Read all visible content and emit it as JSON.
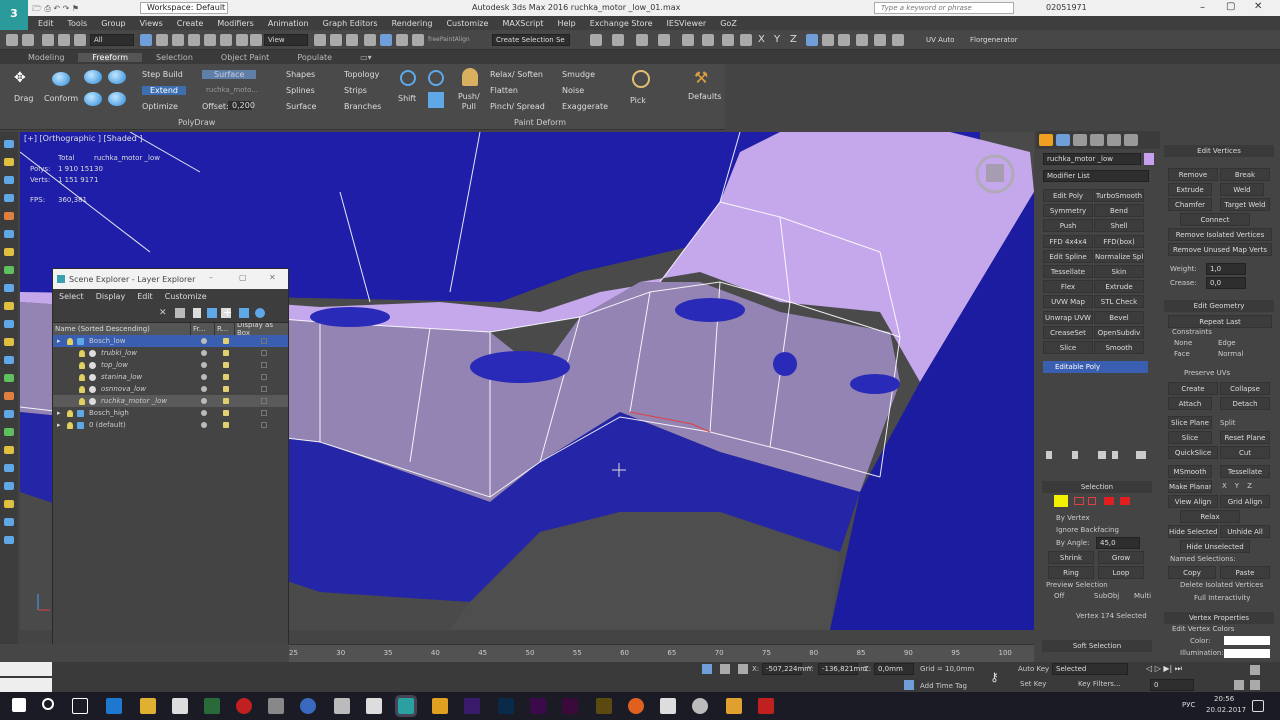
{
  "title_bar": {
    "workspace": "Workspace: Default",
    "title": "Autodesk 3ds Max 2016      ruchka_motor _low_01.max",
    "search_placeholder": "Type a keyword or phrase",
    "user": "02051971"
  },
  "menu": [
    "Edit",
    "Tools",
    "Group",
    "Views",
    "Create",
    "Modifiers",
    "Animation",
    "Graph Editors",
    "Rendering",
    "Customize",
    "MAXScript",
    "Help",
    "Exchange Store",
    "IESViewer",
    "GoZ"
  ],
  "toolbar": {
    "selection_filter": "All",
    "ref_coord": "View",
    "named_selection": "Create Selection Se",
    "plugin": "freePaintAlign",
    "axes": [
      "X",
      "Y",
      "Z"
    ],
    "uv_auto": "UV Auto",
    "florgenerator": "Florgenerator"
  },
  "ribbon_tabs": [
    "Modeling",
    "Freeform",
    "Selection",
    "Object Paint",
    "Populate"
  ],
  "ribbon_active": "Freeform",
  "ribbon": {
    "drag": "Drag",
    "conform": "Conform",
    "step_build": "Step Build",
    "extend": "Extend",
    "optimize": "Optimize",
    "surface_btn": "Surface",
    "surface_target": "ruchka_moto...",
    "offset_label": "Offset:",
    "offset_value": "0,200",
    "shapes": "Shapes",
    "splines": "Splines",
    "surface": "Surface",
    "topology": "Topology",
    "strips": "Strips",
    "branches": "Branches",
    "shift": "Shift",
    "push_pull": "Push/\nPull",
    "relax_soften": "Relax/ Soften",
    "flatten": "Flatten",
    "pinch_spread": "Pinch/ Spread",
    "smudge": "Smudge",
    "noise": "Noise",
    "exaggerate": "Exaggerate",
    "pick": "Pick",
    "defaults": "Defaults",
    "group_polydraw": "PolyDraw",
    "group_paint_deform": "Paint Deform"
  },
  "viewport": {
    "label": "[+] [Orthographic ] [Shaded ]",
    "stats_header_total": "Total",
    "stats_header_object": "ruchka_motor _low",
    "polys_label": "Polys:",
    "polys_total": "1 910 151",
    "polys_obj": "30",
    "verts_label": "Verts:",
    "verts_total": "1 151 917",
    "verts_obj": "1",
    "fps_label": "FPS:",
    "fps": "360,381"
  },
  "scene_explorer": {
    "title": "Scene Explorer - Layer Explorer",
    "menu": [
      "Select",
      "Display",
      "Edit",
      "Customize"
    ],
    "columns": [
      "Name (Sorted Descending)",
      "Fr...",
      "R...",
      "Display as Box"
    ],
    "rows": [
      {
        "name": "Bosch_low",
        "indent": 0,
        "selected": true
      },
      {
        "name": "trubki_low",
        "indent": 2
      },
      {
        "name": "top_low",
        "indent": 2
      },
      {
        "name": "stanina_low",
        "indent": 2
      },
      {
        "name": "osnnova_low",
        "indent": 2
      },
      {
        "name": "ruchka_motor _low",
        "indent": 2,
        "highlight": true
      },
      {
        "name": "Bosch_high",
        "indent": 0
      },
      {
        "name": "0 (default)",
        "indent": 0
      }
    ]
  },
  "command_panel": {
    "object_name": "ruchka_motor _low",
    "modifier_list": "Modifier List",
    "buttons": [
      [
        "Edit Poly",
        "TurboSmooth"
      ],
      [
        "Symmetry",
        "Bend"
      ],
      [
        "Push",
        "Shell"
      ],
      [
        "FFD 4x4x4",
        "FFD(box)"
      ],
      [
        "Edit Spline",
        "Normalize Spl"
      ],
      [
        "Tessellate",
        "Skin"
      ],
      [
        "Flex",
        "Extrude"
      ],
      [
        "UVW Map",
        "STL Check"
      ],
      [
        "Unwrap UVW",
        "Bevel"
      ],
      [
        "CreaseSet",
        "OpenSubdiv"
      ],
      [
        "Slice",
        "Smooth"
      ]
    ],
    "stack_item": "Editable Poly",
    "selection_header": "Selection",
    "by_vertex": "By Vertex",
    "ignore_backfacing": "Ignore Backfacing",
    "by_angle": "By Angle:",
    "by_angle_value": "45,0",
    "shrink": "Shrink",
    "grow": "Grow",
    "ring": "Ring",
    "loop": "Loop",
    "preview_selection": "Preview Selection",
    "preview_options": [
      "Off",
      "SubObj",
      "Multi"
    ],
    "selected_info": "Vertex 174 Selected",
    "soft_selection": "Soft Selection"
  },
  "edit_panel": {
    "edit_vertices": "Edit Vertices",
    "remove": "Remove",
    "break": "Break",
    "extrude": "Extrude",
    "weld": "Weld",
    "chamfer": "Chamfer",
    "target_weld": "Target Weld",
    "connect": "Connect",
    "remove_isolated": "Remove Isolated Vertices",
    "remove_unused": "Remove Unused Map Verts",
    "weight_label": "Weight:",
    "weight": "1,0",
    "crease_label": "Crease:",
    "crease": "0,0",
    "edit_geometry": "Edit Geometry",
    "repeat_last": "Repeat Last",
    "constraints": "Constraints",
    "c_none": "None",
    "c_edge": "Edge",
    "c_face": "Face",
    "c_normal": "Normal",
    "preserve_uvs": "Preserve UVs",
    "create": "Create",
    "collapse": "Collapse",
    "attach": "Attach",
    "detach": "Detach",
    "slice_plane": "Slice Plane",
    "split": "Split",
    "slice": "Slice",
    "reset_plane": "Reset Plane",
    "quickslice": "QuickSlice",
    "cut": "Cut",
    "msmooth": "MSmooth",
    "tessellate": "Tessellate",
    "make_planar": "Make Planar",
    "xyz": [
      "X",
      "Y",
      "Z"
    ],
    "view_align": "View Align",
    "grid_align": "Grid Align",
    "relax": "Relax",
    "hide_selected": "Hide Selected",
    "unhide_all": "Unhide All",
    "hide_unselected": "Hide Unselected",
    "named_selections": "Named Selections:",
    "copy": "Copy",
    "paste": "Paste",
    "delete_isolated": "Delete Isolated Vertices",
    "full_interactivity": "Full Interactivity",
    "vertex_properties": "Vertex Properties",
    "edit_vertex_colors": "Edit Vertex Colors",
    "color_label": "Color:",
    "illumination_label": "Illumination:"
  },
  "timeline": {
    "ticks": [
      "25",
      "30",
      "35",
      "40",
      "45",
      "50",
      "55",
      "60",
      "65",
      "70",
      "75",
      "80",
      "85",
      "90",
      "95",
      "100"
    ]
  },
  "status": {
    "x_label": "X:",
    "x": "-507,224mm",
    "y_label": "Y:",
    "y": "-136,821mm",
    "z_label": "Z:",
    "z": "0,0mm",
    "grid": "Grid = 10,0mm",
    "add_time_tag": "Add Time Tag",
    "auto_key": "Auto Key",
    "set_key": "Set Key",
    "key_mode": "Selected",
    "key_filters": "Key Filters...",
    "frame": "0"
  },
  "taskbar": {
    "lang": "РУС",
    "time": "20:56",
    "date": "20.02.2017"
  }
}
